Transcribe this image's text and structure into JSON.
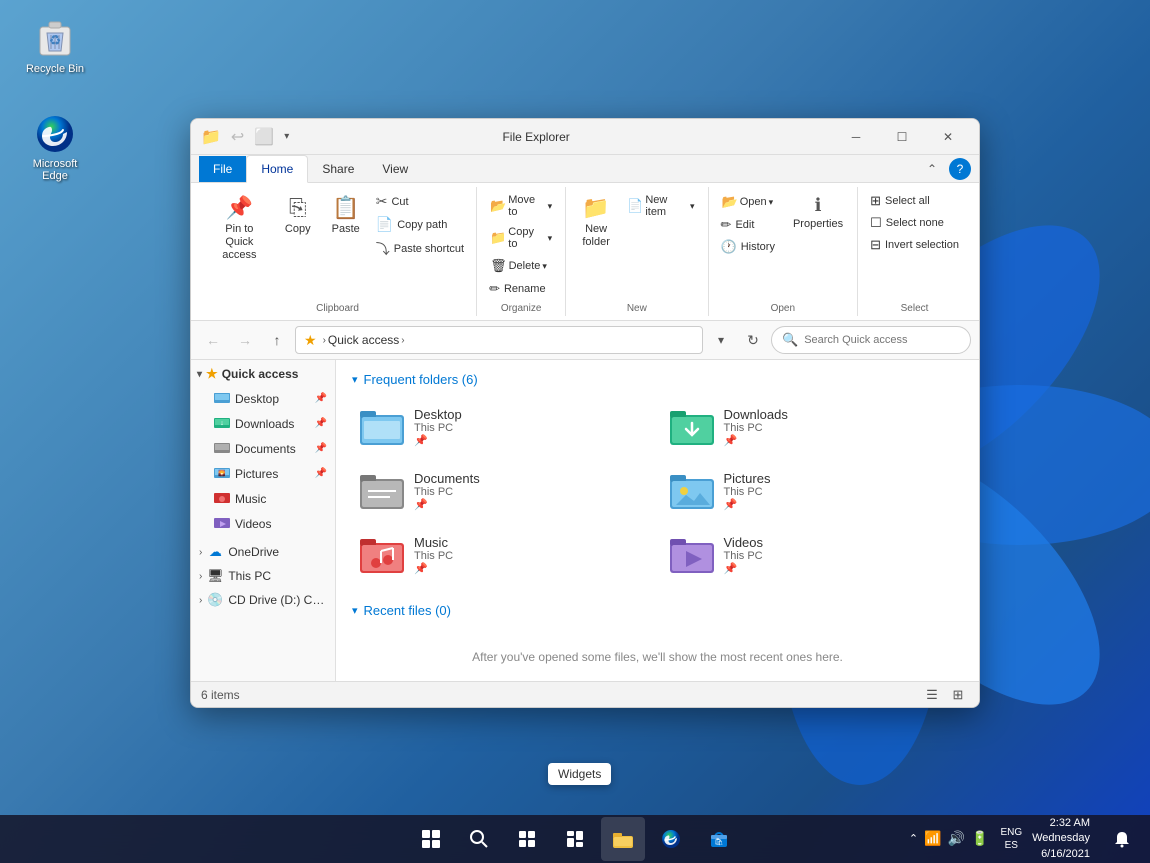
{
  "desktop": {
    "recycle_bin": {
      "label": "Recycle Bin"
    },
    "ms_edge": {
      "label": "Microsoft Edge"
    }
  },
  "widgets_tooltip": {
    "label": "Widgets"
  },
  "taskbar": {
    "start_label": "Start",
    "search_label": "Search",
    "taskview_label": "Task View",
    "widgets_label": "Widgets",
    "explorer_label": "File Explorer",
    "edge_label": "Microsoft Edge",
    "store_label": "Microsoft Store",
    "lang": "ENG\nES",
    "time": "2:32 AM",
    "date": "Wednesday\n6/16/2021",
    "notification_label": "Notifications"
  },
  "window": {
    "title": "File Explorer",
    "tabs": {
      "file": "File",
      "home": "Home",
      "share": "Share",
      "view": "View"
    },
    "active_tab": "Home",
    "ribbon": {
      "clipboard": {
        "label": "Clipboard",
        "pin": "Pin to Quick\naccess",
        "copy": "Copy",
        "paste": "Paste",
        "cut": "Cut",
        "copy_path": "Copy path",
        "paste_shortcut": "Paste shortcut"
      },
      "organize": {
        "label": "Organize",
        "move_to": "Move to",
        "copy_to": "Copy to",
        "delete": "Delete",
        "rename": "Rename"
      },
      "new": {
        "label": "New",
        "new_folder": "New\nfolder",
        "new_item": "New item"
      },
      "open_group": {
        "label": "Open",
        "open": "Open",
        "edit": "Edit",
        "history": "History",
        "properties": "Properties"
      },
      "select": {
        "label": "Select",
        "select_all": "Select all",
        "select_none": "Select none",
        "invert": "Invert selection"
      }
    },
    "address_bar": {
      "path": "Quick access",
      "placeholder": "Search Quick access"
    },
    "sidebar": {
      "quick_access": "Quick access",
      "items": [
        {
          "label": "Desktop",
          "pin": true,
          "icon": "🖥️"
        },
        {
          "label": "Downloads",
          "pin": true,
          "icon": "⬇️"
        },
        {
          "label": "Documents",
          "pin": true,
          "icon": "📄"
        },
        {
          "label": "Pictures",
          "pin": true,
          "icon": "🖼️"
        },
        {
          "label": "Music",
          "pin": false,
          "icon": "🎵"
        },
        {
          "label": "Videos",
          "pin": false,
          "icon": "📹"
        }
      ],
      "onedrive": "OneDrive",
      "this_pc": "This PC",
      "cd_drive": "CD Drive (D:) CC0..."
    },
    "frequent_folders": {
      "title": "Frequent folders (6)",
      "folders": [
        {
          "name": "Desktop",
          "path": "This PC",
          "color": "desktop"
        },
        {
          "name": "Downloads",
          "path": "This PC",
          "color": "downloads"
        },
        {
          "name": "Documents",
          "path": "This PC",
          "color": "documents"
        },
        {
          "name": "Pictures",
          "path": "This PC",
          "color": "pictures"
        },
        {
          "name": "Music",
          "path": "This PC",
          "color": "music"
        },
        {
          "name": "Videos",
          "path": "This PC",
          "color": "videos"
        }
      ]
    },
    "recent_files": {
      "title": "Recent files (0)",
      "empty_message": "After you've opened some files, we'll show the most recent ones here."
    },
    "status": {
      "items": "6 items",
      "view_list": "☰",
      "view_grid": "⊞"
    }
  }
}
